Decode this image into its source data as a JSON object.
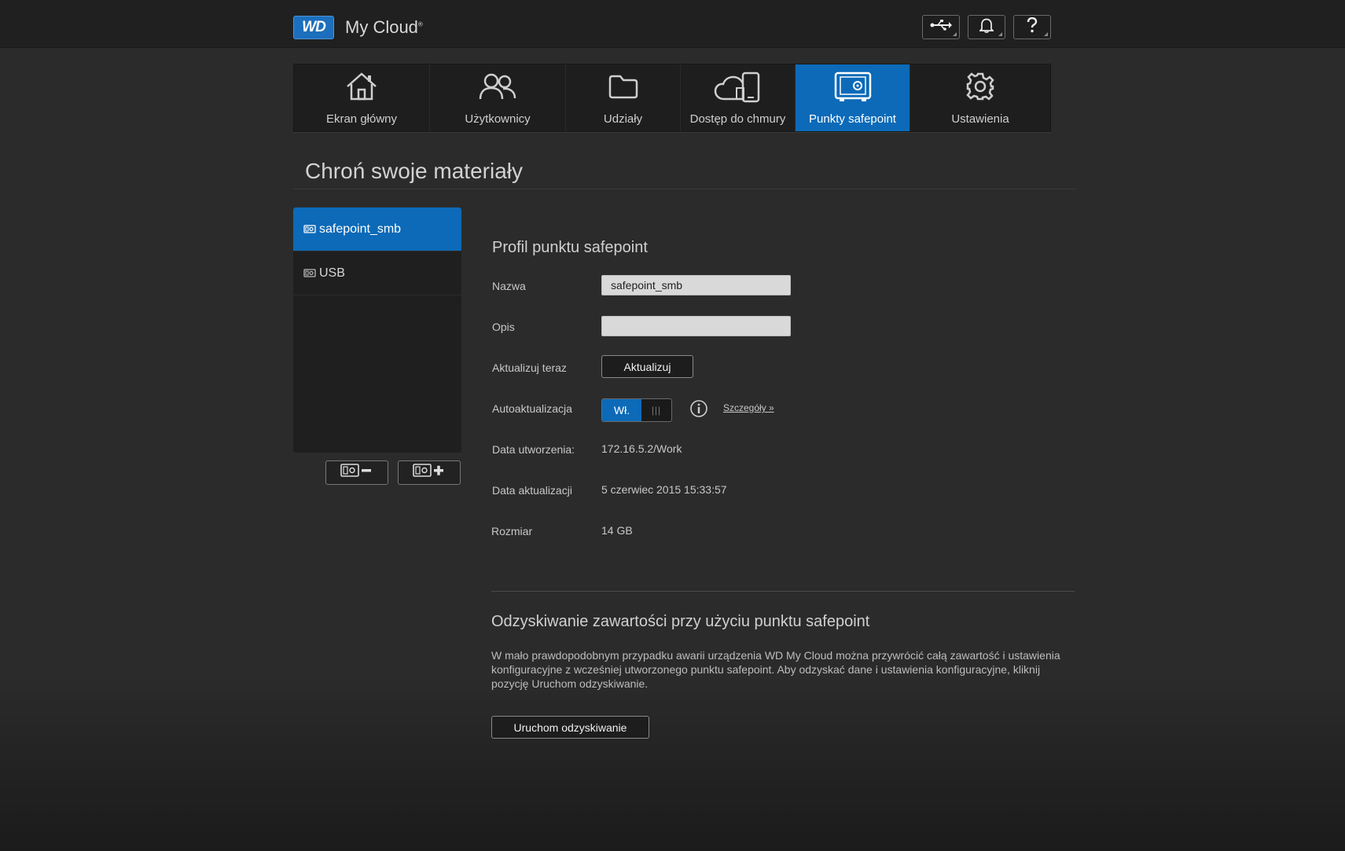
{
  "header": {
    "logo_badge": "WD",
    "app_title": "My Cloud",
    "trademark": "®",
    "icons": [
      "usb-icon",
      "bell-icon",
      "help-icon"
    ]
  },
  "nav": {
    "items": [
      {
        "label": "Ekran główny",
        "icon": "home-icon"
      },
      {
        "label": "Użytkownicy",
        "icon": "users-icon"
      },
      {
        "label": "Udziały",
        "icon": "folder-icon"
      },
      {
        "label": "Dostęp do chmury",
        "icon": "cloud-device-icon"
      },
      {
        "label": "Punkty safepoint",
        "icon": "safe-icon",
        "active": true
      },
      {
        "label": "Ustawienia",
        "icon": "gear-icon"
      }
    ]
  },
  "page": {
    "title": "Chroń swoje materiały"
  },
  "safepoints": {
    "items": [
      {
        "label": "safepoint_smb",
        "active": true
      },
      {
        "label": "USB"
      }
    ]
  },
  "profile": {
    "title": "Profil punktu safepoint",
    "name_label": "Nazwa",
    "name_value": "safepoint_smb",
    "desc_label": "Opis",
    "desc_value": "",
    "update_now_label": "Aktualizuj teraz",
    "update_button": "Aktualizuj",
    "auto_update_label": "Autoaktualizacja",
    "toggle_on": "Wł.",
    "toggle_grip": "|||",
    "details_link": "Szczegóły »",
    "created_label": "Data utworzenia:",
    "created_value": "172.16.5.2/Work",
    "updated_label": "Data aktualizacji",
    "updated_value": "5 czerwiec 2015 15:33:57",
    "size_label": "Rozmiar",
    "size_value": "14 GB"
  },
  "recovery": {
    "title": "Odzyskiwanie zawartości przy użyciu punktu safepoint",
    "text": "W mało prawdopodobnym przypadku awarii urządzenia WD My Cloud można przywrócić całą zawartość i ustawienia konfiguracyjne z wcześniej utworzonego punktu safepoint. Aby odzyskać dane i ustawienia konfiguracyjne, kliknij pozycję Uruchom odzyskiwanie.",
    "button": "Uruchom odzyskiwanie"
  },
  "colors": {
    "accent": "#0c6ab8",
    "background": "#2b2b2b",
    "header": "#202020"
  }
}
